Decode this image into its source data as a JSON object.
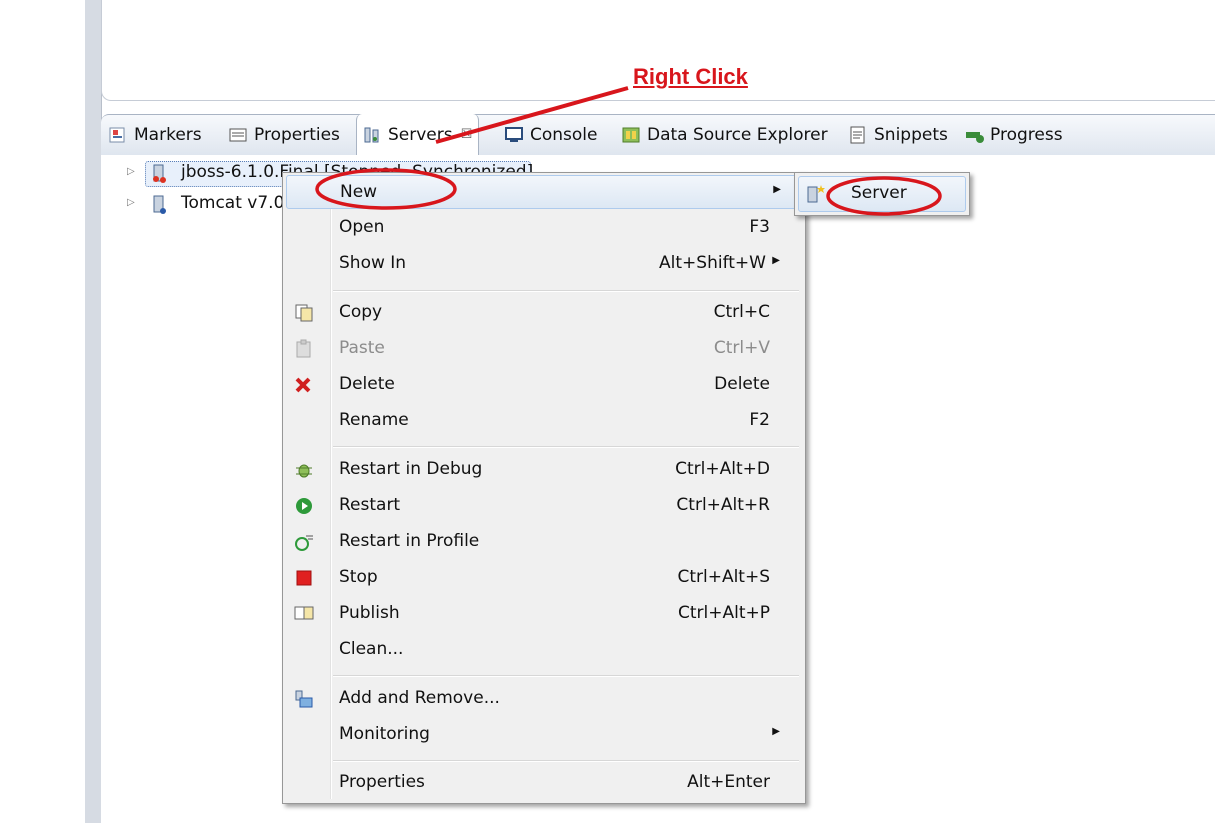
{
  "annotation": {
    "text": "Right Click"
  },
  "tabs": [
    {
      "label": "Markers",
      "icon": "markers-icon"
    },
    {
      "label": "Properties",
      "icon": "properties-icon"
    },
    {
      "label": "Servers",
      "icon": "servers-icon",
      "active": true,
      "close": "☒"
    },
    {
      "label": "Console",
      "icon": "console-icon"
    },
    {
      "label": "Data Source Explorer",
      "icon": "data-source-explorer-icon"
    },
    {
      "label": "Snippets",
      "icon": "snippets-icon"
    },
    {
      "label": "Progress",
      "icon": "progress-icon"
    }
  ],
  "servers": [
    {
      "label": "jboss-6.1.0.Final [Stopped, Synchronized]",
      "visible": "jboss-6.1.0.Fi..."
    },
    {
      "label": "Tomcat v7.0"
    }
  ],
  "context_menu": {
    "items": [
      {
        "label": "New",
        "accel": "",
        "submenu": true,
        "highlighted": true
      },
      {
        "label": "Open",
        "accel": "F3"
      },
      {
        "label": "Show In",
        "accel": "Alt+Shift+W",
        "submenu": true
      },
      {
        "label": "Copy",
        "accel": "Ctrl+C",
        "icon": "copy-icon"
      },
      {
        "label": "Paste",
        "accel": "Ctrl+V",
        "icon": "paste-icon",
        "disabled": true
      },
      {
        "label": "Delete",
        "accel": "Delete",
        "icon": "delete-icon"
      },
      {
        "label": "Rename",
        "accel": "F2"
      },
      {
        "label": "Restart in Debug",
        "accel": "Ctrl+Alt+D",
        "icon": "debug-icon"
      },
      {
        "label": "Restart",
        "accel": "Ctrl+Alt+R",
        "icon": "restart-icon"
      },
      {
        "label": "Restart in Profile",
        "accel": "",
        "icon": "profile-icon"
      },
      {
        "label": "Stop",
        "accel": "Ctrl+Alt+S",
        "icon": "stop-icon"
      },
      {
        "label": "Publish",
        "accel": "Ctrl+Alt+P",
        "icon": "publish-icon"
      },
      {
        "label": "Clean...",
        "accel": ""
      },
      {
        "label": "Add and Remove...",
        "accel": "",
        "icon": "add-remove-icon"
      },
      {
        "label": "Monitoring",
        "accel": "",
        "submenu": true
      },
      {
        "label": "Properties",
        "accel": "Alt+Enter"
      }
    ]
  },
  "submenu": {
    "items": [
      {
        "label": "Server",
        "icon": "new-server-icon"
      }
    ]
  },
  "colors": {
    "annotation_red": "#d8161c",
    "menu_bg": "#f0f0f0",
    "tab_border": "#a9b4c4"
  }
}
